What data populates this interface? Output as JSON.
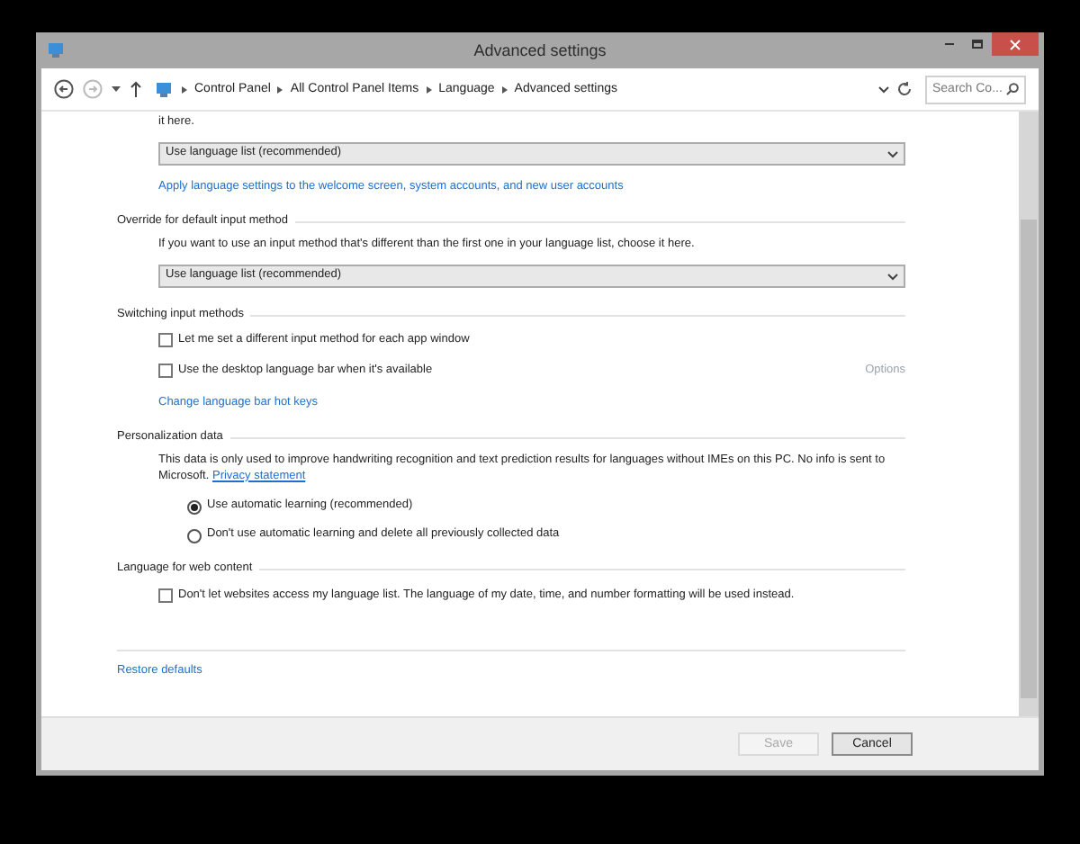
{
  "window": {
    "title": "Advanced settings"
  },
  "breadcrumb": [
    "Control Panel",
    "All Control Panel Items",
    "Language",
    "Advanced settings"
  ],
  "search": {
    "placeholder": "Search Co..."
  },
  "sections": [
    {
      "items": [
        {
          "kind": "text",
          "text": "it here."
        },
        {
          "kind": "dropdown",
          "value": "Use language list (recommended)"
        },
        {
          "kind": "link",
          "text": "Apply language settings to the welcome screen, system accounts, and new user accounts"
        }
      ]
    },
    {
      "heading": "Override for default input method",
      "items": [
        {
          "kind": "text",
          "text": "If you want to use an input method that's different than the first one in your language list, choose it here."
        },
        {
          "kind": "dropdown",
          "value": "Use language list (recommended)"
        }
      ]
    },
    {
      "heading": "Switching input methods",
      "items": [
        {
          "kind": "checkbox",
          "label": "Let me set a different input method for each app window",
          "checked": false
        },
        {
          "kind": "checkbox",
          "label": "Use the desktop language bar when it's available",
          "checked": false,
          "aside": {
            "text": "Options",
            "disabled": true
          }
        },
        {
          "kind": "link",
          "text": "Change language bar hot keys"
        }
      ]
    },
    {
      "heading": "Personalization data",
      "items": [
        {
          "kind": "paragraph",
          "text": "This data is only used to improve handwriting recognition and text prediction results for languages without IMEs on this PC. No info is sent to Microsoft.",
          "link": "Privacy statement"
        },
        {
          "kind": "radio",
          "label": "Use automatic learning (recommended)",
          "selected": true
        },
        {
          "kind": "radio",
          "label": "Don't use automatic learning and delete all previously collected data",
          "selected": false
        }
      ]
    },
    {
      "heading": "Language for web content",
      "items": [
        {
          "kind": "checkbox",
          "label": "Don't let websites access my language list. The language of my date, time, and number formatting will be used instead.",
          "checked": false
        }
      ]
    }
  ],
  "restore_link": "Restore defaults",
  "buttons": [
    {
      "label": "Save",
      "disabled": true
    },
    {
      "label": "Cancel",
      "disabled": false
    }
  ]
}
